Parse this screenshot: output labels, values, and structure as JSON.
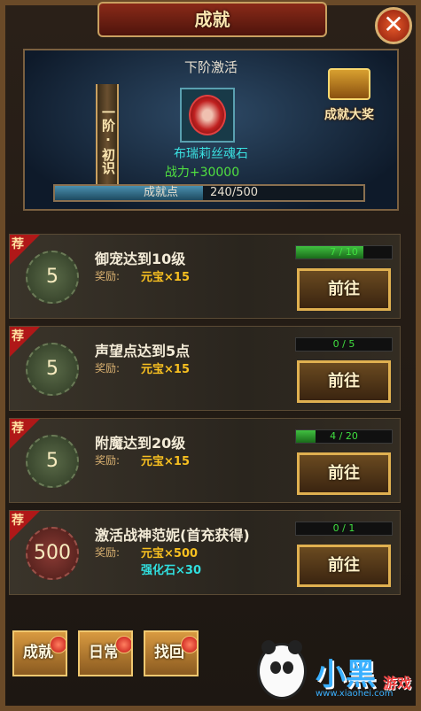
{
  "header": {
    "title": "成就",
    "close_glyph": "✕"
  },
  "banner": {
    "next_activate": "下阶激活",
    "stage_label": "一阶·初识",
    "item_name": "布瑞莉丝魂石",
    "item_power": "战力+30000",
    "chest_label": "成就大奖",
    "progress_label": "成就点",
    "progress_text": "240/500",
    "progress_fraction": 0.48
  },
  "tasks": [
    {
      "recommend": "荐",
      "badge": "5",
      "badge_style": "green",
      "title": "御宠达到10级",
      "reward_label": "奖励:",
      "reward_1": "元宝×15",
      "reward_2": "",
      "progress_text": "7 / 10",
      "progress_fraction": 0.7,
      "button_label": "前往"
    },
    {
      "recommend": "荐",
      "badge": "5",
      "badge_style": "green",
      "title": "声望点达到5点",
      "reward_label": "奖励:",
      "reward_1": "元宝×15",
      "reward_2": "",
      "progress_text": "0 / 5",
      "progress_fraction": 0.0,
      "button_label": "前往"
    },
    {
      "recommend": "荐",
      "badge": "5",
      "badge_style": "green",
      "title": "附魔达到20级",
      "reward_label": "奖励:",
      "reward_1": "元宝×15",
      "reward_2": "",
      "progress_text": "4 / 20",
      "progress_fraction": 0.2,
      "button_label": "前往"
    },
    {
      "recommend": "荐",
      "badge": "500",
      "badge_style": "red",
      "title": "激活战神范妮(首充获得)",
      "reward_label": "奖励:",
      "reward_1": "元宝×500",
      "reward_2": "强化石×30",
      "progress_text": "0 / 1",
      "progress_fraction": 0.0,
      "button_label": "前往"
    }
  ],
  "bottom_tabs": [
    {
      "label": "成就"
    },
    {
      "label": "日常"
    },
    {
      "label": "找回"
    }
  ],
  "watermark": {
    "text": "小黑",
    "text2": "游戏",
    "url": "www.xiaohei.com"
  },
  "colors": {
    "accent_gold": "#e0b050",
    "title_red": "#8a2a18",
    "progress_green": "#40c040",
    "reward_cyan": "#30e0e0"
  }
}
